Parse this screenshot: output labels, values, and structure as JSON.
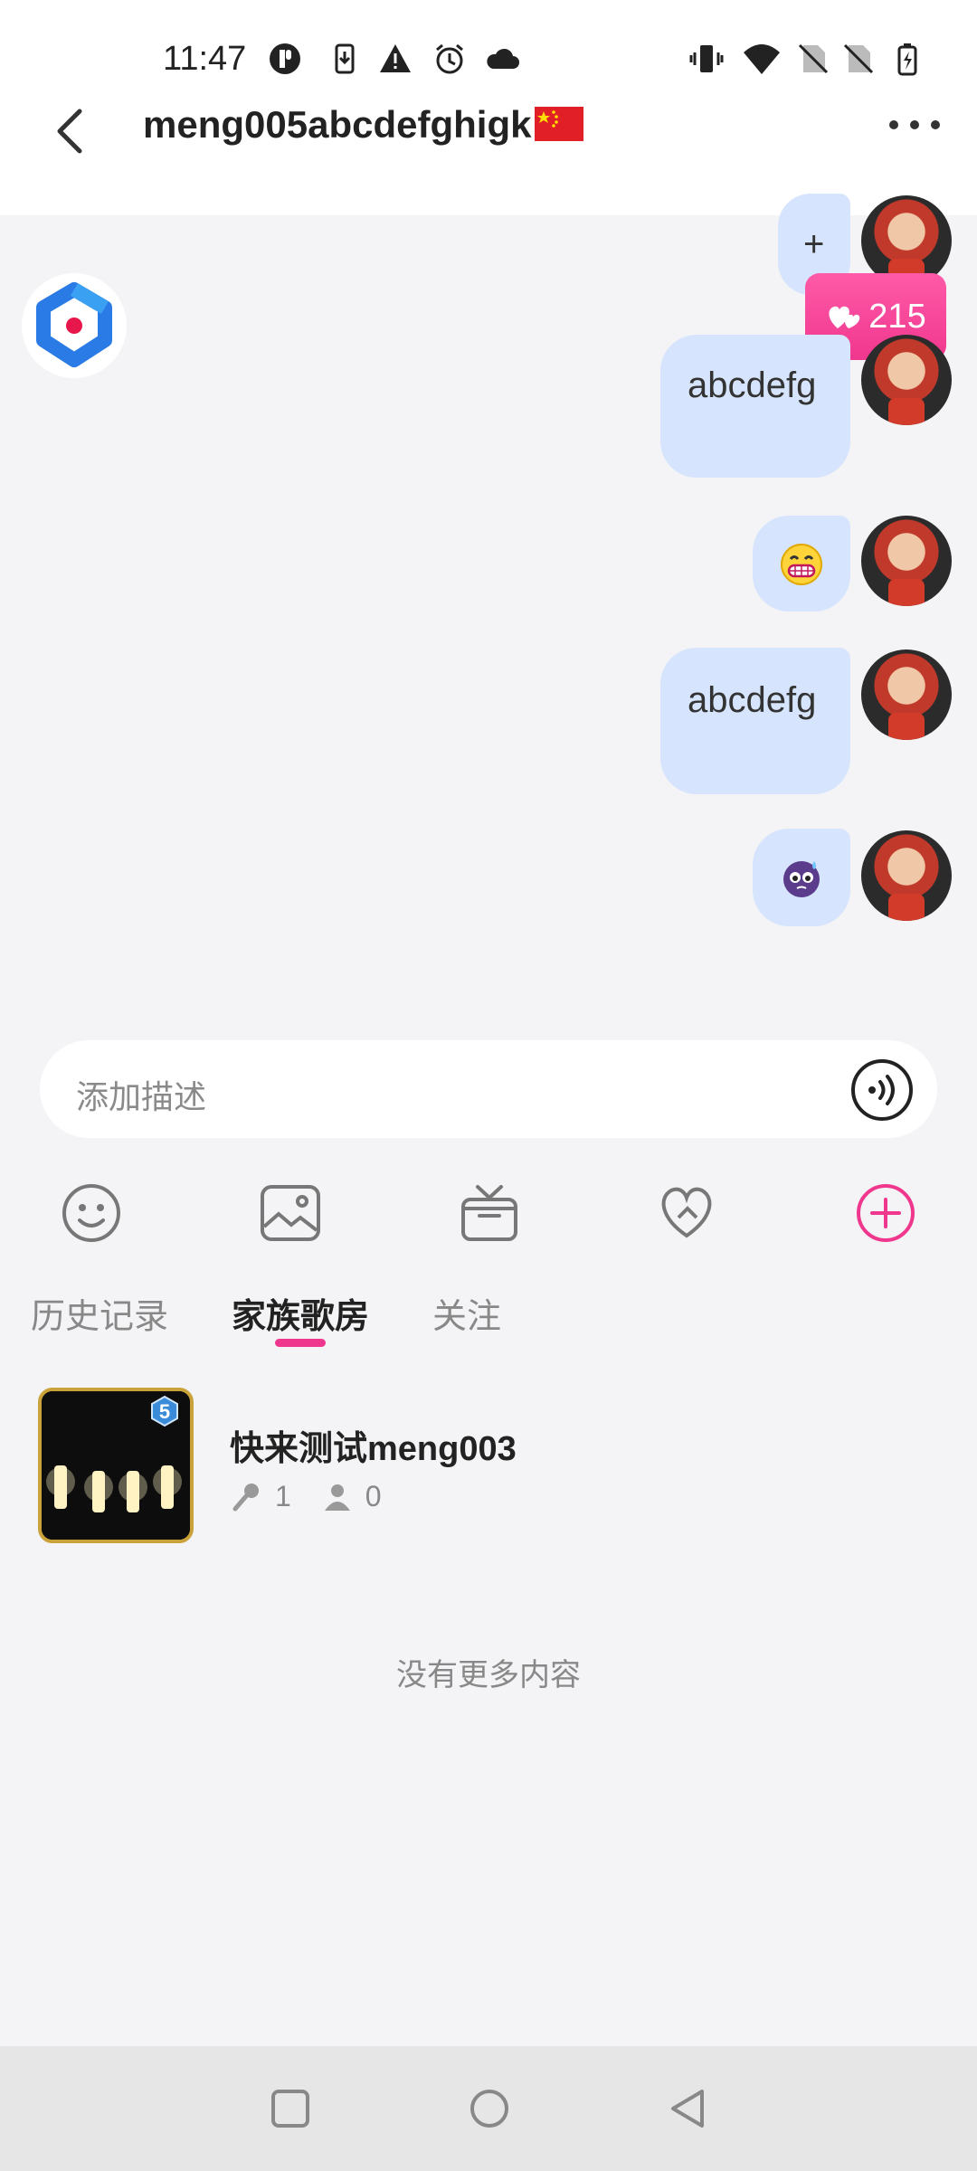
{
  "status_bar": {
    "time": "11:47",
    "icons": [
      "app-notification-icon",
      "download-icon",
      "warning-icon",
      "alarm-icon",
      "cloud-icon",
      "vibrate-icon",
      "wifi-icon",
      "no-sim-icon",
      "no-sim-icon",
      "battery-charging-icon"
    ]
  },
  "header": {
    "title": "meng005abcdefghigk",
    "flag_icon": "china-flag-icon",
    "back_icon": "chevron-left-icon",
    "more_icon": "more-dots-icon"
  },
  "chat": {
    "messages": [
      {
        "side": "right",
        "type": "text",
        "text": "+"
      },
      {
        "side": "right",
        "type": "text",
        "text": "abcdefg"
      },
      {
        "side": "right",
        "type": "emoji",
        "icon": "grinning-emoji-icon"
      },
      {
        "side": "right",
        "type": "text",
        "text": "abcdefg"
      },
      {
        "side": "right",
        "type": "emoji",
        "icon": "purple-sweat-emoji-icon"
      }
    ],
    "likes_badge": {
      "icon": "hearts-icon",
      "count": "215"
    },
    "colors": {
      "bubble": "#d6e5fd",
      "accent": "#f0378e"
    }
  },
  "input": {
    "placeholder": "添加描述",
    "voice_icon": "voice-icon"
  },
  "toolbar": {
    "icons": [
      "emoji-icon",
      "image-icon",
      "gift-icon",
      "heart-chat-icon",
      "add-icon"
    ]
  },
  "tabs": [
    {
      "label": "历史记录",
      "active": false
    },
    {
      "label": "家族歌房",
      "active": true
    },
    {
      "label": "关注",
      "active": false
    }
  ],
  "rooms": [
    {
      "title": "快来测试meng003",
      "level": "5",
      "mic_count": "1",
      "listener_count": "0"
    }
  ],
  "list_footer": "没有更多内容",
  "nav": {
    "icons": [
      "recent-apps-icon",
      "home-icon",
      "back-triangle-icon"
    ]
  }
}
